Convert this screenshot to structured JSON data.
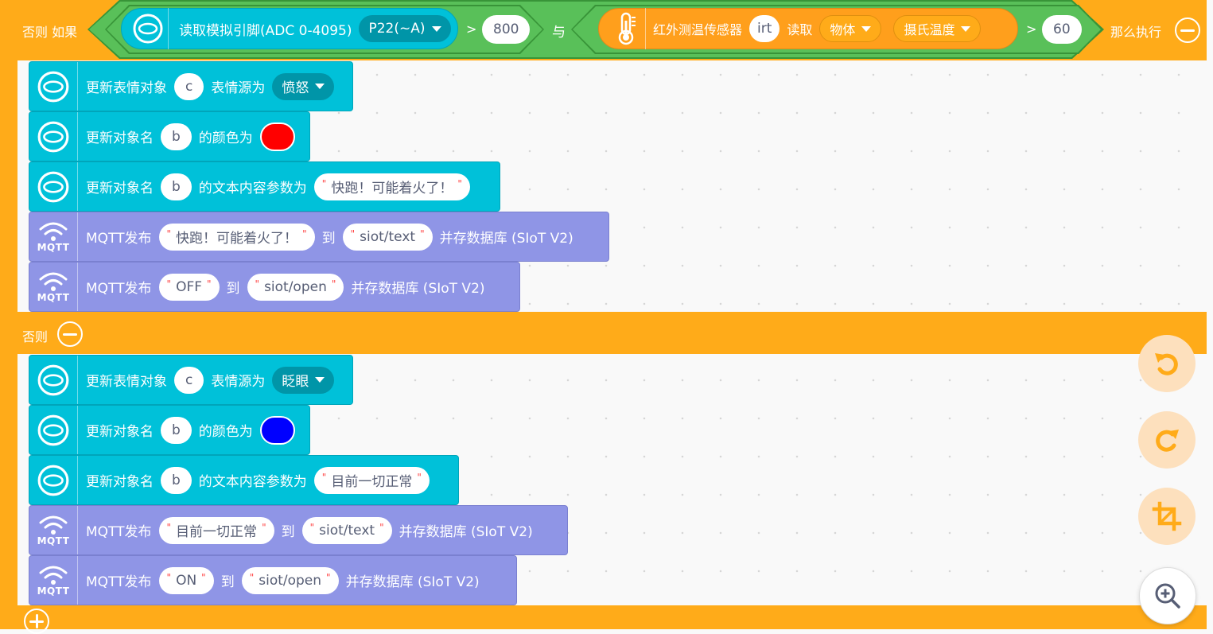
{
  "control": {
    "else_if_label": "否则 如果",
    "then_label": "那么执行",
    "else_label": "否则"
  },
  "condition": {
    "left": {
      "label": "读取模拟引脚(ADC 0-4095)",
      "pin": "P22(~A)",
      "op": ">",
      "value": "800"
    },
    "joiner": "与",
    "right": {
      "label": "红外测温传感器",
      "name": "irt",
      "read_label": "读取",
      "target": "物体",
      "unit": "摄氏温度",
      "op": ">",
      "value": "60"
    }
  },
  "then_blocks": {
    "emotion": {
      "label1": "更新表情对象",
      "obj": "c",
      "label2": "表情源为",
      "value": "愤怒"
    },
    "color": {
      "label1": "更新对象名",
      "obj": "b",
      "label2": "的颜色为",
      "color": "#ff0000"
    },
    "text": {
      "label1": "更新对象名",
      "obj": "b",
      "label2": "的文本内容参数为",
      "value": "快跑！可能着火了！"
    },
    "mqtt1": {
      "label1": "MQTT发布",
      "msg": "快跑！可能着火了！",
      "to": "到",
      "topic": "siot/text",
      "suffix": "并存数据库 (SIoT V2)"
    },
    "mqtt2": {
      "label1": "MQTT发布",
      "msg": "OFF",
      "to": "到",
      "topic": "siot/open",
      "suffix": "并存数据库 (SIoT V2)"
    }
  },
  "else_blocks": {
    "emotion": {
      "label1": "更新表情对象",
      "obj": "c",
      "label2": "表情源为",
      "value": "眨眼"
    },
    "color": {
      "label1": "更新对象名",
      "obj": "b",
      "label2": "的颜色为",
      "color": "#0000ff"
    },
    "text": {
      "label1": "更新对象名",
      "obj": "b",
      "label2": "的文本内容参数为",
      "value": "目前一切正常"
    },
    "mqtt1": {
      "label1": "MQTT发布",
      "msg": "目前一切正常",
      "to": "到",
      "topic": "siot/text",
      "suffix": "并存数据库 (SIoT V2)"
    },
    "mqtt2": {
      "label1": "MQTT发布",
      "msg": "ON",
      "to": "到",
      "topic": "siot/open",
      "suffix": "并存数据库 (SIoT V2)"
    }
  },
  "mqtt_icon_label": "MQTT",
  "workspace_controls": [
    "undo-icon",
    "redo-icon",
    "crop-icon",
    "zoom-in-icon"
  ],
  "colors": {
    "control": "#ffab19",
    "operator": "#59c059",
    "unihiker": "#00c1d9",
    "mqtt": "#8f95e6",
    "sensor": "#ff9f1c"
  }
}
